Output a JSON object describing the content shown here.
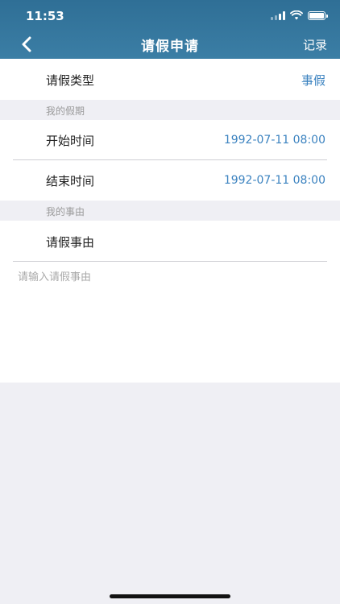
{
  "status_bar": {
    "time": "11:53",
    "icons": [
      "signal-icon",
      "wifi-icon",
      "battery-icon"
    ]
  },
  "nav": {
    "back_icon": "chevron-left-icon",
    "title": "请假申请",
    "right_action": "记录"
  },
  "form": {
    "leave_type": {
      "label": "请假类型",
      "value": "事假"
    },
    "section_vacation": "我的假期",
    "start_time": {
      "label": "开始时间",
      "value": "1992-07-11 08:00"
    },
    "end_time": {
      "label": "结束时间",
      "value": "1992-07-11 08:00"
    },
    "section_reason": "我的事由",
    "reason": {
      "label": "请假事由",
      "placeholder": "请输入请假事由",
      "value": ""
    }
  },
  "colors": {
    "nav_background": "#3b7ea5",
    "accent_value": "#3c83c0",
    "page_background": "#efeff4"
  }
}
